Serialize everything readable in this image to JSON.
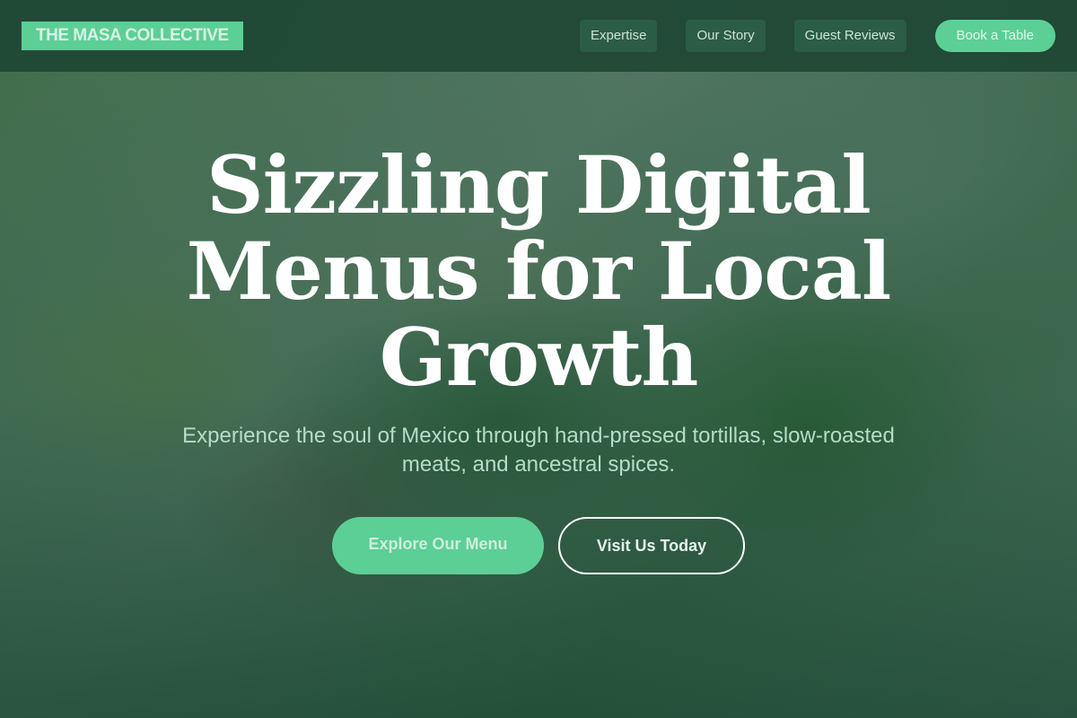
{
  "header": {
    "logo_text": "THE MASA COLLECTIVE",
    "nav": [
      {
        "label": "Expertise"
      },
      {
        "label": "Our Story"
      },
      {
        "label": "Guest Reviews"
      }
    ],
    "cta_label": "Book a Table"
  },
  "hero": {
    "title": "Sizzling Digital Menus for Local Growth",
    "subtitle": "Experience the soul of Mexico through hand-pressed tortillas, slow-roasted meats, and ancestral spices.",
    "primary_button": "Explore Our Menu",
    "secondary_button": "Visit Us Today"
  },
  "colors": {
    "accent": "#5ccf96",
    "header_bg": "#1e4634",
    "overlay": "#1f503a",
    "title_text": "#ffffff",
    "subtitle_text": "#b7dcc9"
  }
}
